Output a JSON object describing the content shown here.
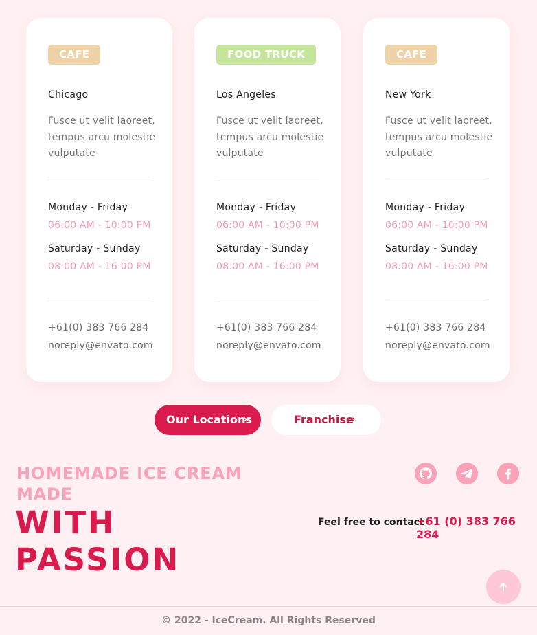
{
  "locations": [
    {
      "type": "cafe",
      "badge_color": "#f0d2a8",
      "city": "Chicago",
      "description": "Fusce ut velit laoreet, tempus arcu molestie vulputate",
      "weekday_label": "Monday - Friday",
      "weekday_hours": "06:00 AM - 10:00 PM",
      "weekend_label": "Saturday - Sunday",
      "weekend_hours": "08:00 AM - 16:00 PM",
      "phone": "+61(0) 383 766 284",
      "email": "noreply@envato.com"
    },
    {
      "type": "food truck",
      "badge_color": "#c4e59b",
      "city": "Los Angeles",
      "description": "Fusce ut velit laoreet, tempus arcu molestie vulputate",
      "weekday_label": "Monday - Friday",
      "weekday_hours": "06:00 AM - 10:00 PM",
      "weekend_label": "Saturday - Sunday",
      "weekend_hours": "08:00 AM - 16:00 PM",
      "phone": "+61(0) 383 766 284",
      "email": "noreply@envato.com"
    },
    {
      "type": "cafe",
      "badge_color": "#f0d2a8",
      "city": "New York",
      "description": "Fusce ut velit laoreet, tempus arcu molestie vulputate",
      "weekday_label": "Monday - Friday",
      "weekday_hours": "06:00 AM - 10:00 PM",
      "weekend_label": "Saturday - Sunday",
      "weekend_hours": "08:00 AM - 16:00 PM",
      "phone": "+61(0) 383 766 284",
      "email": "noreply@envato.com"
    }
  ],
  "actions": {
    "our_locations": "Our Locations",
    "franchise": "Franchise",
    "chevron": "›"
  },
  "footer": {
    "tagline_small": "Homemade ice cream made",
    "tagline_large": "With passion",
    "social_icons": [
      "github-icon",
      "telegram-icon",
      "facebook-icon"
    ],
    "contact_label": "Feel free to contact",
    "contact_phone": "+61 (0) 383 766 284",
    "copyright": "© 2022 - IceCream. All Rights Reserved"
  },
  "colors": {
    "accent": "#d81a4c",
    "accent_light": "#f9a2b8",
    "background": "#fff1f3"
  }
}
